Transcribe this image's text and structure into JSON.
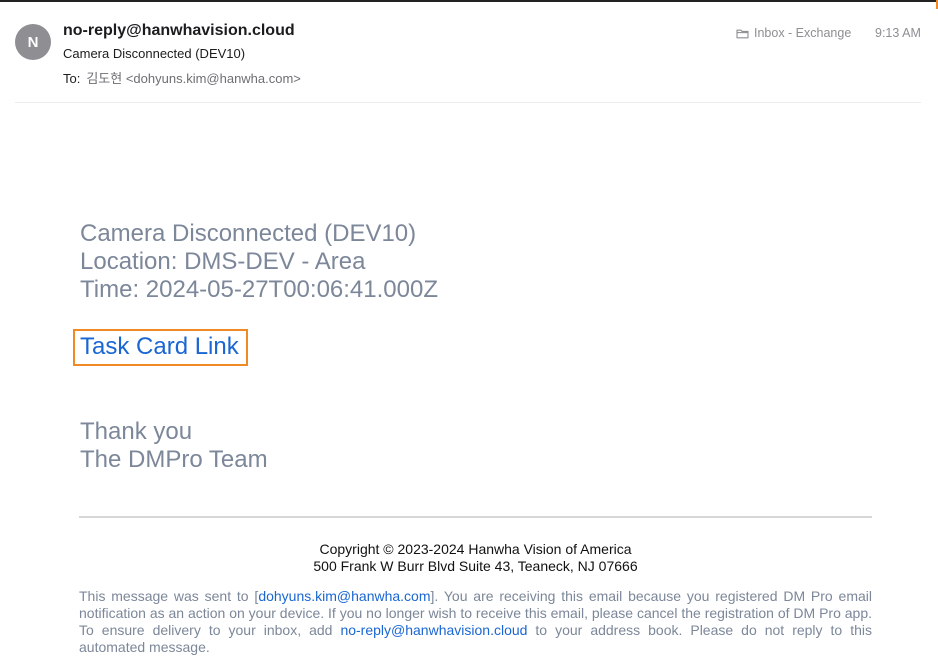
{
  "header": {
    "avatar_initial": "N",
    "sender": "no-reply@hanwhavision.cloud",
    "subject": "Camera Disconnected (DEV10)",
    "to_label": "To:",
    "to_value": "김도현 <dohyuns.kim@hanwha.com>",
    "folder": "Inbox - Exchange",
    "time": "9:13 AM",
    "folder_icon": "folder-icon"
  },
  "body": {
    "line1": "Camera Disconnected (DEV10)",
    "line2": "Location: DMS-DEV - Area",
    "line3": "Time: 2024-05-27T00:06:41.000Z",
    "link_text": "Task Card Link",
    "thanks": "Thank you",
    "team": "The DMPro Team"
  },
  "footer": {
    "copyright_line1": "Copyright © 2023-2024 Hanwha Vision of America",
    "copyright_line2": "500 Frank W Burr Blvd Suite 43, Teaneck, NJ 07666",
    "notice_part1": "This message was sent to [",
    "notice_email": "dohyuns.kim@hanwha.com",
    "notice_part2": "]. You are receiving this email because you registered DM Pro email notification as an action on your device. If you no longer wish to receive this email, please cancel the registration of DM Pro app. To ensure delivery to your inbox, add ",
    "notice_sender": "no-reply@hanwhavision.cloud",
    "notice_part3": " to your address book. Please do not reply to this automated message."
  },
  "colors": {
    "accent_link": "#1a66d2",
    "highlight_border": "#f08a24",
    "body_text": "#7c8799"
  }
}
